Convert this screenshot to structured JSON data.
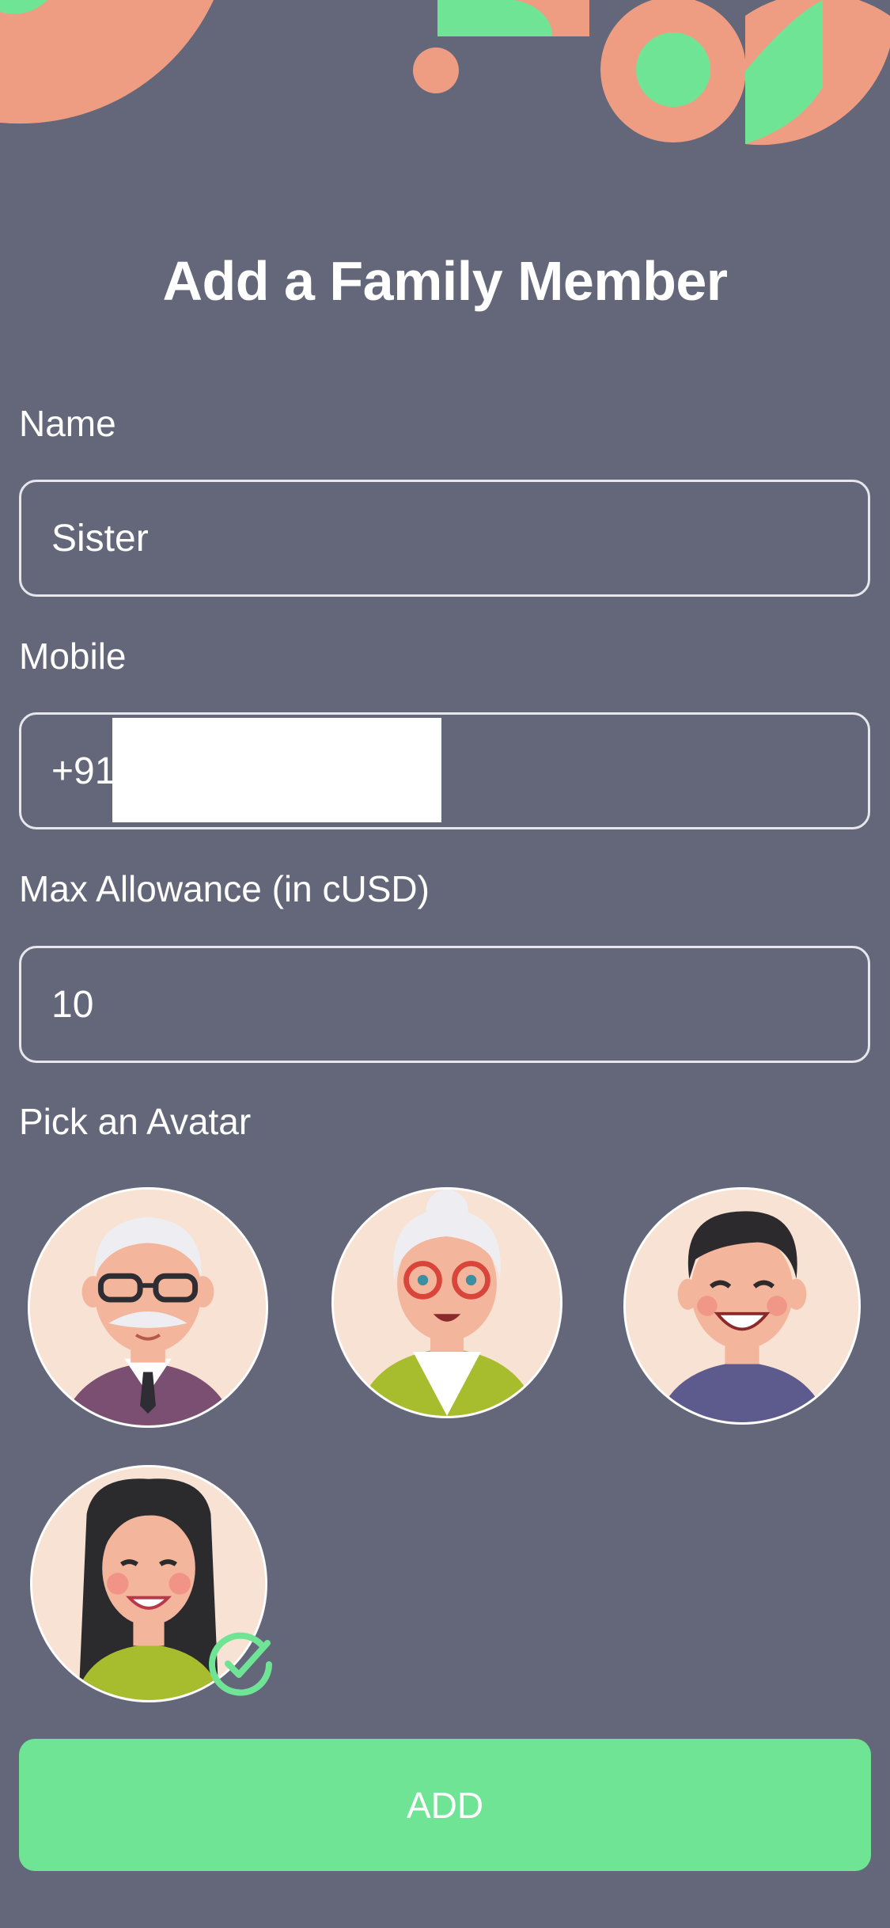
{
  "page": {
    "title": "Add a Family Member"
  },
  "form": {
    "name_label": "Name",
    "name_value": "Sister",
    "mobile_label": "Mobile",
    "mobile_value": "+91",
    "allowance_label": "Max Allowance (in cUSD)",
    "allowance_value": "10",
    "avatar_label": "Pick an Avatar"
  },
  "avatars": [
    {
      "name": "grandfather-avatar",
      "selected": false
    },
    {
      "name": "grandmother-avatar",
      "selected": false
    },
    {
      "name": "young-man-avatar",
      "selected": false
    },
    {
      "name": "young-woman-avatar",
      "selected": true
    }
  ],
  "actions": {
    "add_label": "ADD"
  },
  "colors": {
    "background": "#646779",
    "accent_green": "#6fe495",
    "accent_salmon": "#ee9d83"
  }
}
